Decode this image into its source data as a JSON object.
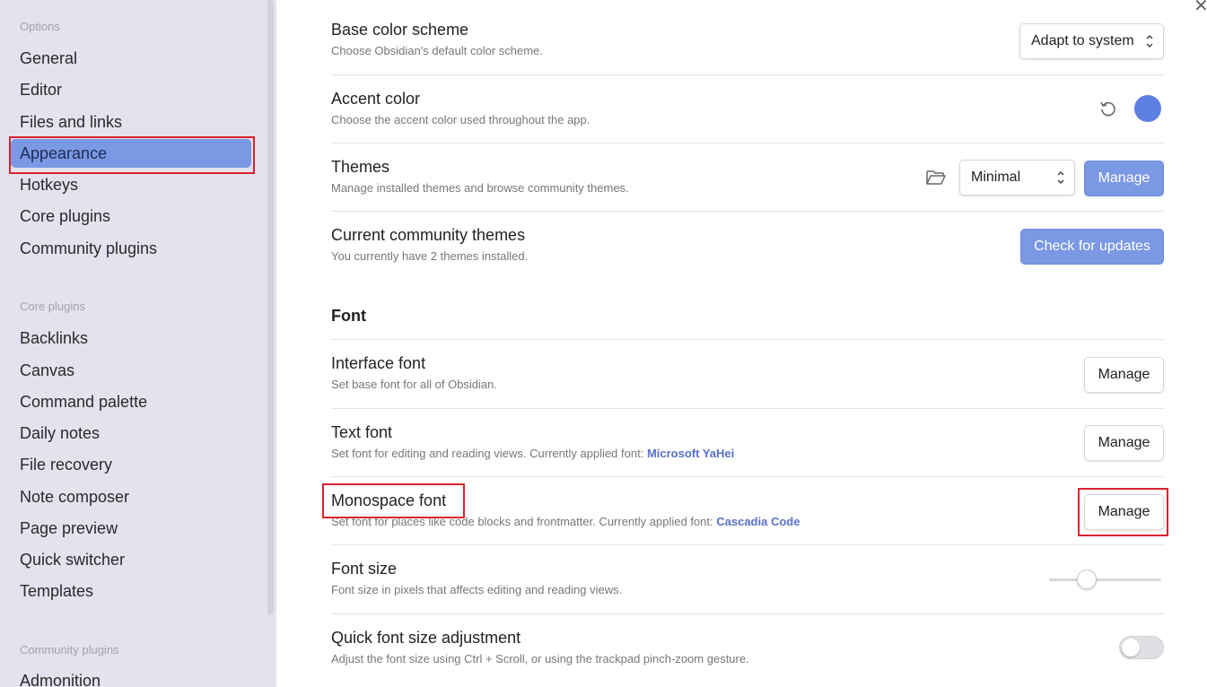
{
  "sidebar": {
    "options_heading": "Options",
    "options_items": [
      "General",
      "Editor",
      "Files and links",
      "Appearance",
      "Hotkeys",
      "Core plugins",
      "Community plugins"
    ],
    "active_item": "Appearance",
    "core_heading": "Core plugins",
    "core_items": [
      "Backlinks",
      "Canvas",
      "Command palette",
      "Daily notes",
      "File recovery",
      "Note composer",
      "Page preview",
      "Quick switcher",
      "Templates"
    ],
    "community_heading": "Community plugins",
    "community_items": [
      "Admonition"
    ]
  },
  "close_icon": "close-icon",
  "settings": {
    "base_color_scheme": {
      "name": "Base color scheme",
      "desc": "Choose Obsidian's default color scheme.",
      "value": "Adapt to system"
    },
    "accent_color": {
      "name": "Accent color",
      "desc": "Choose the accent color used throughout the app.",
      "color": "#5c7fe0"
    },
    "themes": {
      "name": "Themes",
      "desc": "Manage installed themes and browse community themes.",
      "value": "Minimal",
      "button": "Manage"
    },
    "community_themes": {
      "name": "Current community themes",
      "desc": "You currently have 2 themes installed.",
      "button": "Check for updates"
    },
    "font_section": "Font",
    "interface_font": {
      "name": "Interface font",
      "desc": "Set base font for all of Obsidian.",
      "button": "Manage"
    },
    "text_font": {
      "name": "Text font",
      "desc": "Set font for editing and reading views. Currently applied font:",
      "font": "Microsoft YaHei",
      "button": "Manage"
    },
    "monospace_font": {
      "name": "Monospace font",
      "desc": "Set font for places like code blocks and frontmatter. Currently applied font:",
      "font": "Cascadia Code",
      "button": "Manage"
    },
    "font_size": {
      "name": "Font size",
      "desc": "Font size in pixels that affects editing and reading views."
    },
    "quick_font_size": {
      "name": "Quick font size adjustment",
      "desc": "Adjust the font size using Ctrl + Scroll, or using the trackpad pinch-zoom gesture.",
      "enabled": false
    }
  },
  "colors": {
    "accent": "#7a98e3",
    "highlight_box": "#d9232e"
  }
}
